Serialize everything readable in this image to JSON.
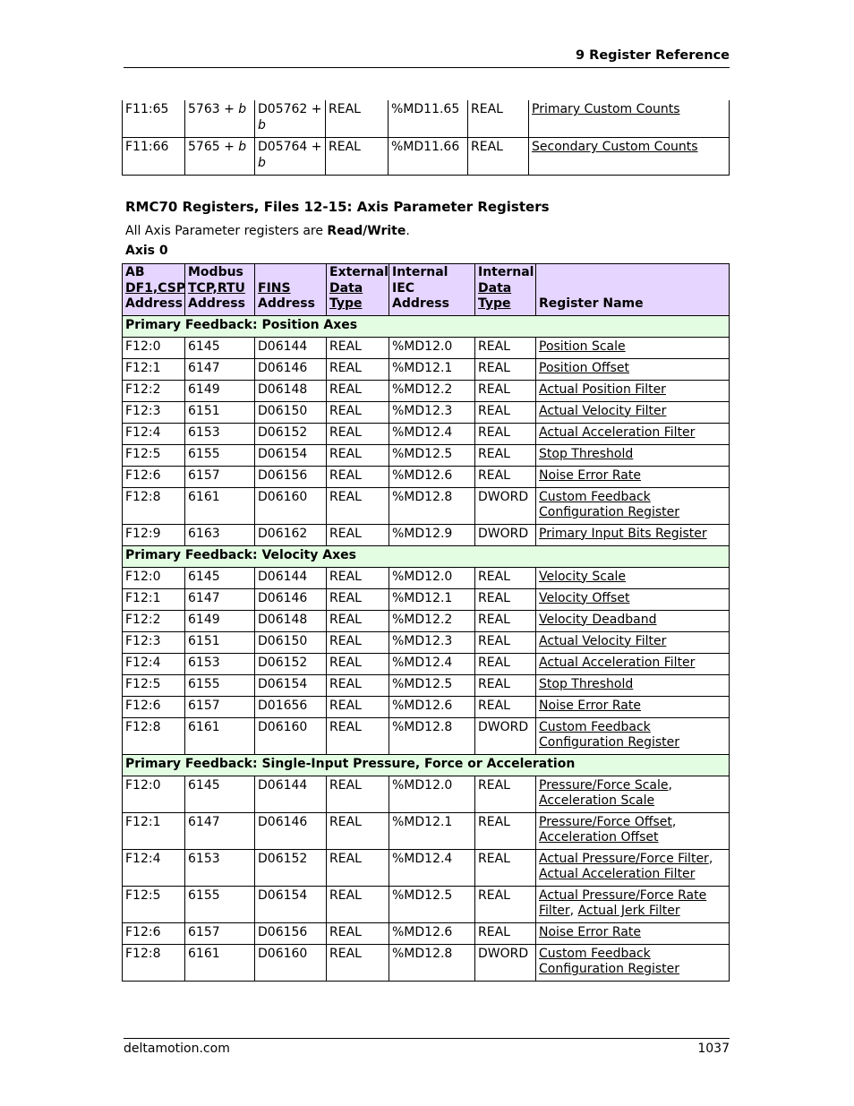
{
  "header": {
    "chapter": "9  Register Reference"
  },
  "top_rows": [
    {
      "ab": "F11:65",
      "modbus": "5763 + ",
      "modbus_var": "b",
      "fins": "D05762 + ",
      "fins_var": "b",
      "ext": "REAL",
      "iec": "%MD11.65",
      "int": "REAL",
      "name": "Primary Custom Counts"
    },
    {
      "ab": "F11:66",
      "modbus": "5765 + ",
      "modbus_var": "b",
      "fins": "D05764 + ",
      "fins_var": "b",
      "ext": "REAL",
      "iec": "%MD11.66",
      "int": "REAL",
      "name": "Secondary Custom Counts"
    }
  ],
  "section": {
    "title": "RMC70 Registers, Files 12-15: Axis Parameter Registers",
    "intro_prefix": "All Axis Parameter registers are ",
    "intro_bold": "Read/Write",
    "intro_suffix": ".",
    "axis_label": "Axis 0"
  },
  "table_header": {
    "col1": [
      "AB",
      "DF1,CSP",
      "Address"
    ],
    "col2": [
      "Modbus",
      "TCP,RTU",
      "Address"
    ],
    "col3": [
      "FINS",
      "Address"
    ],
    "col4": [
      "External",
      "Data",
      "Type"
    ],
    "col5": [
      "Internal",
      "IEC",
      "Address"
    ],
    "col6": [
      "Internal",
      "Data",
      "Type"
    ],
    "col7": "Register Name"
  },
  "groups": [
    {
      "title": "Primary Feedback: Position Axes",
      "rows": [
        {
          "ab": "F12:0",
          "modbus": "6145",
          "fins": "D06144",
          "ext": "REAL",
          "iec": "%MD12.0",
          "int": "REAL",
          "names": [
            "Position Scale"
          ]
        },
        {
          "ab": "F12:1",
          "modbus": "6147",
          "fins": "D06146",
          "ext": "REAL",
          "iec": "%MD12.1",
          "int": "REAL",
          "names": [
            "Position Offset"
          ]
        },
        {
          "ab": "F12:2",
          "modbus": "6149",
          "fins": "D06148",
          "ext": "REAL",
          "iec": "%MD12.2",
          "int": "REAL",
          "names": [
            "Actual Position Filter"
          ]
        },
        {
          "ab": "F12:3",
          "modbus": "6151",
          "fins": "D06150",
          "ext": "REAL",
          "iec": "%MD12.3",
          "int": "REAL",
          "names": [
            "Actual Velocity Filter"
          ]
        },
        {
          "ab": "F12:4",
          "modbus": "6153",
          "fins": "D06152",
          "ext": "REAL",
          "iec": "%MD12.4",
          "int": "REAL",
          "names": [
            "Actual Acceleration Filter"
          ]
        },
        {
          "ab": "F12:5",
          "modbus": "6155",
          "fins": "D06154",
          "ext": "REAL",
          "iec": "%MD12.5",
          "int": "REAL",
          "names": [
            "Stop Threshold"
          ]
        },
        {
          "ab": "F12:6",
          "modbus": "6157",
          "fins": "D06156",
          "ext": "REAL",
          "iec": "%MD12.6",
          "int": "REAL",
          "names": [
            "Noise Error Rate"
          ]
        },
        {
          "ab": "F12:8",
          "modbus": "6161",
          "fins": "D06160",
          "ext": "REAL",
          "iec": "%MD12.8",
          "int": "DWORD",
          "names": [
            "Custom Feedback Configuration Register"
          ]
        },
        {
          "ab": "F12:9",
          "modbus": "6163",
          "fins": "D06162",
          "ext": "REAL",
          "iec": "%MD12.9",
          "int": "DWORD",
          "names": [
            "Primary Input Bits Register"
          ]
        }
      ]
    },
    {
      "title": "Primary Feedback: Velocity Axes",
      "rows": [
        {
          "ab": "F12:0",
          "modbus": "6145",
          "fins": "D06144",
          "ext": "REAL",
          "iec": "%MD12.0",
          "int": "REAL",
          "names": [
            "Velocity Scale"
          ]
        },
        {
          "ab": "F12:1",
          "modbus": "6147",
          "fins": "D06146",
          "ext": "REAL",
          "iec": "%MD12.1",
          "int": "REAL",
          "names": [
            "Velocity Offset"
          ]
        },
        {
          "ab": "F12:2",
          "modbus": "6149",
          "fins": "D06148",
          "ext": "REAL",
          "iec": "%MD12.2",
          "int": "REAL",
          "names": [
            "Velocity Deadband"
          ]
        },
        {
          "ab": "F12:3",
          "modbus": "6151",
          "fins": "D06150",
          "ext": "REAL",
          "iec": "%MD12.3",
          "int": "REAL",
          "names": [
            "Actual Velocity Filter"
          ]
        },
        {
          "ab": "F12:4",
          "modbus": "6153",
          "fins": "D06152",
          "ext": "REAL",
          "iec": "%MD12.4",
          "int": "REAL",
          "names": [
            "Actual Acceleration Filter"
          ]
        },
        {
          "ab": "F12:5",
          "modbus": "6155",
          "fins": "D06154",
          "ext": "REAL",
          "iec": "%MD12.5",
          "int": "REAL",
          "names": [
            "Stop Threshold"
          ]
        },
        {
          "ab": "F12:6",
          "modbus": "6157",
          "fins": "D01656",
          "ext": "REAL",
          "iec": "%MD12.6",
          "int": "REAL",
          "names": [
            "Noise Error Rate"
          ]
        },
        {
          "ab": "F12:8",
          "modbus": "6161",
          "fins": "D06160",
          "ext": "REAL",
          "iec": "%MD12.8",
          "int": "DWORD",
          "names": [
            "Custom Feedback Configuration Register"
          ]
        }
      ]
    },
    {
      "title": "Primary Feedback: Single-Input Pressure, Force or Acceleration",
      "rows": [
        {
          "ab": "F12:0",
          "modbus": "6145",
          "fins": "D06144",
          "ext": "REAL",
          "iec": "%MD12.0",
          "int": "REAL",
          "names": [
            "Pressure/Force Scale",
            "Acceleration Scale"
          ]
        },
        {
          "ab": "F12:1",
          "modbus": "6147",
          "fins": "D06146",
          "ext": "REAL",
          "iec": "%MD12.1",
          "int": "REAL",
          "names": [
            "Pressure/Force Offset",
            "Acceleration Offset"
          ]
        },
        {
          "ab": "F12:4",
          "modbus": "6153",
          "fins": "D06152",
          "ext": "REAL",
          "iec": "%MD12.4",
          "int": "REAL",
          "names": [
            "Actual Pressure/Force Filter",
            "Actual Acceleration Filter"
          ]
        },
        {
          "ab": "F12:5",
          "modbus": "6155",
          "fins": "D06154",
          "ext": "REAL",
          "iec": "%MD12.5",
          "int": "REAL",
          "names": [
            "Actual Pressure/Force Rate Filter",
            "Actual Jerk Filter"
          ]
        },
        {
          "ab": "F12:6",
          "modbus": "6157",
          "fins": "D06156",
          "ext": "REAL",
          "iec": "%MD12.6",
          "int": "REAL",
          "names": [
            "Noise Error Rate"
          ]
        },
        {
          "ab": "F12:8",
          "modbus": "6161",
          "fins": "D06160",
          "ext": "REAL",
          "iec": "%MD12.8",
          "int": "DWORD",
          "names": [
            "Custom Feedback Configuration Register"
          ]
        }
      ]
    }
  ],
  "colors": {
    "header_bg": "#e5d5ff",
    "section_bg": "#e3fde3"
  },
  "footer": {
    "site": "deltamotion.com",
    "page": "1037"
  }
}
